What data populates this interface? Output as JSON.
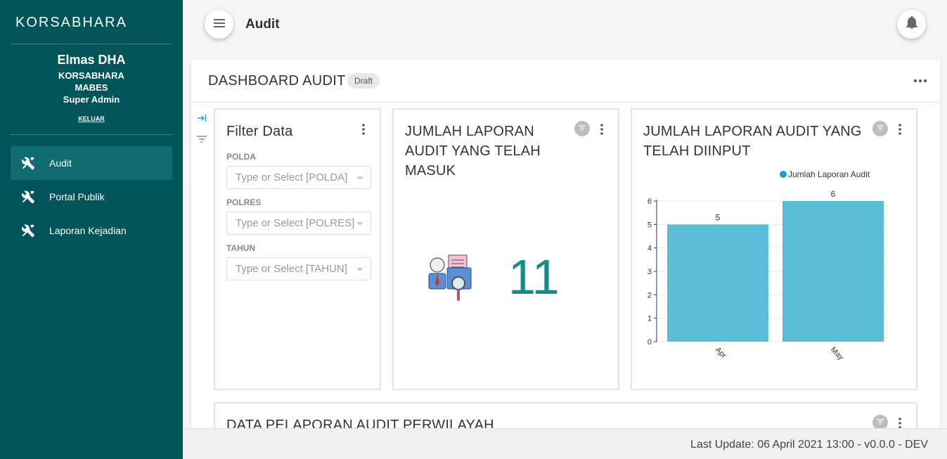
{
  "sidebar": {
    "brand": "KORSABHARA",
    "user": {
      "name": "Elmas DHA",
      "org": "KORSABHARA",
      "unit": "MABES",
      "role": "Super Admin",
      "logout": "KELUAR"
    },
    "items": [
      {
        "label": "Audit",
        "icon": "tools-icon",
        "active": true
      },
      {
        "label": "Portal Publik",
        "icon": "tools-icon",
        "active": false
      },
      {
        "label": "Laporan Kejadian",
        "icon": "tools-icon",
        "active": false
      }
    ]
  },
  "header": {
    "title": "Audit",
    "menu_icon": "hamburger-icon",
    "notification_icon": "bell-icon"
  },
  "dashboard": {
    "title": "DASHBOARD AUDIT",
    "badge": "Draft"
  },
  "filter_panel": {
    "title": "Filter Data",
    "fields": [
      {
        "label": "POLDA",
        "placeholder": "Type or Select [POLDA]"
      },
      {
        "label": "POLRES",
        "placeholder": "Type or Select [POLRES]"
      },
      {
        "label": "TAHUN",
        "placeholder": "Type or Select [TAHUN]"
      }
    ]
  },
  "count_panel": {
    "title": "JUMLAH LAPORAN AUDIT YANG TELAH MASUK",
    "value": "11",
    "icon": "audit-report-icon"
  },
  "chart_panel": {
    "title": "JUMLAH LAPORAN AUDIT YANG TELAH DIINPUT"
  },
  "region_panel": {
    "title": "DATA PELAPORAN AUDIT PERWILAYAH"
  },
  "footer": {
    "text": "Last Update: 06 April 2021 13:00 - v0.0.0 - DEV"
  },
  "colors": {
    "sidebar": "#015558",
    "sidebar_active": "#0e6b70",
    "accent_number": "#178a8a",
    "bar": "#5bbcd7",
    "legend_dot": "#1ba1c9"
  },
  "chart_data": {
    "type": "bar",
    "categories": [
      "Apr",
      "May"
    ],
    "series": [
      {
        "name": "Jumlah Laporan Audit",
        "values": [
          5,
          6
        ]
      }
    ],
    "data_labels": [
      "5",
      "6"
    ],
    "yticks": [
      "0",
      "1",
      "2",
      "3",
      "4",
      "5",
      "6"
    ],
    "ylim": [
      0,
      6
    ],
    "grid": true,
    "legend": "top-right",
    "title": "",
    "xlabel": "",
    "ylabel": ""
  }
}
